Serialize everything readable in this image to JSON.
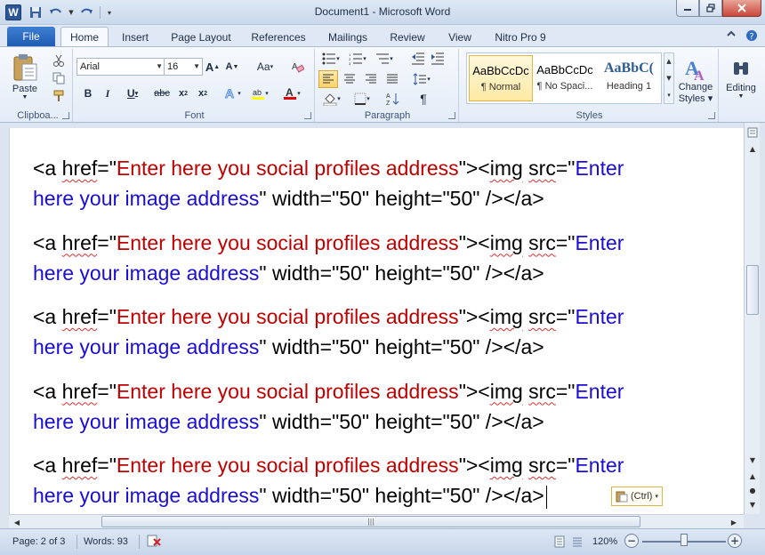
{
  "window": {
    "title": "Document1 - Microsoft Word",
    "app_icon_letter": "W"
  },
  "tabs": {
    "file": "File",
    "items": [
      "Home",
      "Insert",
      "Page Layout",
      "References",
      "Mailings",
      "Review",
      "View",
      "Nitro Pro 9"
    ],
    "active": "Home"
  },
  "ribbon": {
    "clipboard": {
      "label": "Clipboa...",
      "paste": "Paste"
    },
    "font": {
      "label": "Font",
      "name": "Arial",
      "size": "16"
    },
    "paragraph": {
      "label": "Paragraph"
    },
    "styles": {
      "label": "Styles",
      "items": [
        {
          "sample": "AaBbCcDc",
          "name": "¶ Normal"
        },
        {
          "sample": "AaBbCcDc",
          "name": "¶ No Spaci..."
        },
        {
          "sample": "AaBbC(",
          "name": "Heading 1"
        }
      ],
      "change_styles_line1": "Change",
      "change_styles_line2": "Styles",
      "change_styles": "Change Styles"
    },
    "editing": {
      "label": "Editing"
    }
  },
  "document": {
    "line_parts": {
      "open_a": "<a ",
      "href": "href",
      "eq_quote": "=\"",
      "profile_text": "Enter here you social profiles address",
      "close_quote_img": "\"><",
      "img": "img",
      "sp": " ",
      "src": "src",
      "enter": "Enter",
      "image_text": "here your image address",
      "attrs": "\" width=\"50\" height=\"50\" /></a>"
    },
    "paragraph_count": 5,
    "paste_options": "(Ctrl)"
  },
  "statusbar": {
    "page": "Page: 2 of 3",
    "words": "Words: 93",
    "zoom": "120%"
  },
  "colors": {
    "profile_text": "#c00000",
    "image_text": "#1a0dd6",
    "file_tab": "#2a67c0"
  }
}
